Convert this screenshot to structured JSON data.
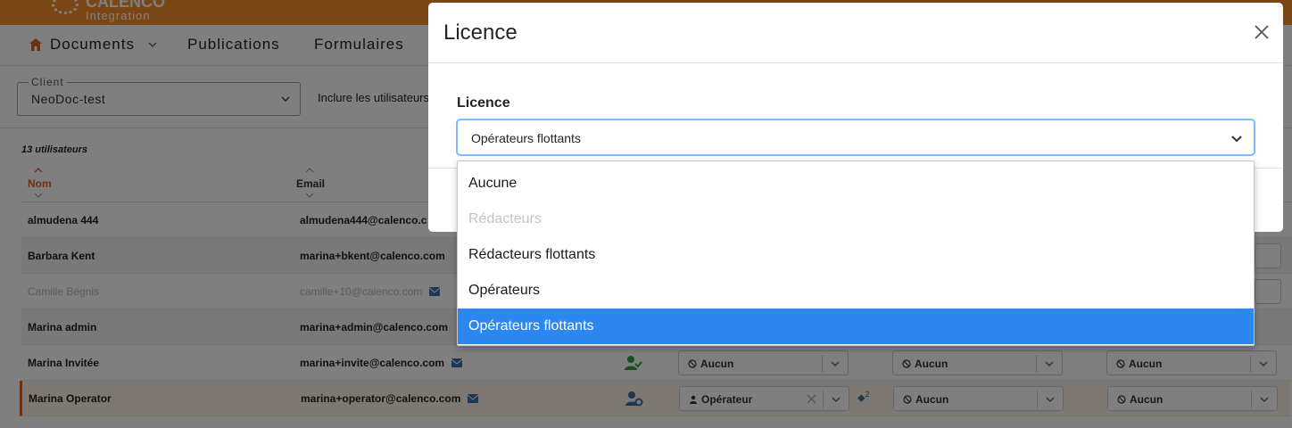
{
  "app": {
    "logo_name": "CALENCO",
    "logo_sub": "Integration",
    "nav": [
      "Documents",
      "Publications",
      "Formulaires"
    ],
    "client_label": "Client",
    "client_value": "NeoDoc-test",
    "include_label": "Inclure les utilisateurs",
    "user_count": "13 utilisateurs",
    "col_nom": "Nom",
    "col_email": "Email",
    "rows": [
      {
        "name": "almudena 444",
        "email": "almudena444@calenco.c"
      },
      {
        "name": "Barbara Kent",
        "email": "marina+bkent@calenco.com"
      },
      {
        "name": "Camille Bégnis",
        "email": "camille+10@calenco.com"
      },
      {
        "name": "Marina admin",
        "email": "marina+admin@calenco.com"
      },
      {
        "name": "Marina Invitée",
        "email": "marina+invite@calenco.com"
      },
      {
        "name": "Marina Operator",
        "email": "marina+operator@calenco.com"
      }
    ],
    "role_aucun": "Aucun",
    "role_operateur": "Opérateur",
    "tag_count": "2",
    "colors": {
      "brand": "#f28c28",
      "accent": "#d9621f",
      "teal": "#1eaab8"
    }
  },
  "modal": {
    "title": "Licence",
    "field_label": "Licence",
    "selected": "Opérateurs flottants",
    "options": [
      {
        "label": "Aucune",
        "state": "normal"
      },
      {
        "label": "Rédacteurs",
        "state": "disabled"
      },
      {
        "label": "Rédacteurs flottants",
        "state": "normal"
      },
      {
        "label": "Opérateurs",
        "state": "normal"
      },
      {
        "label": "Opérateurs flottants",
        "state": "active"
      }
    ],
    "colors": {
      "highlight": "#2d87f0",
      "focus": "#86b7fe"
    }
  }
}
